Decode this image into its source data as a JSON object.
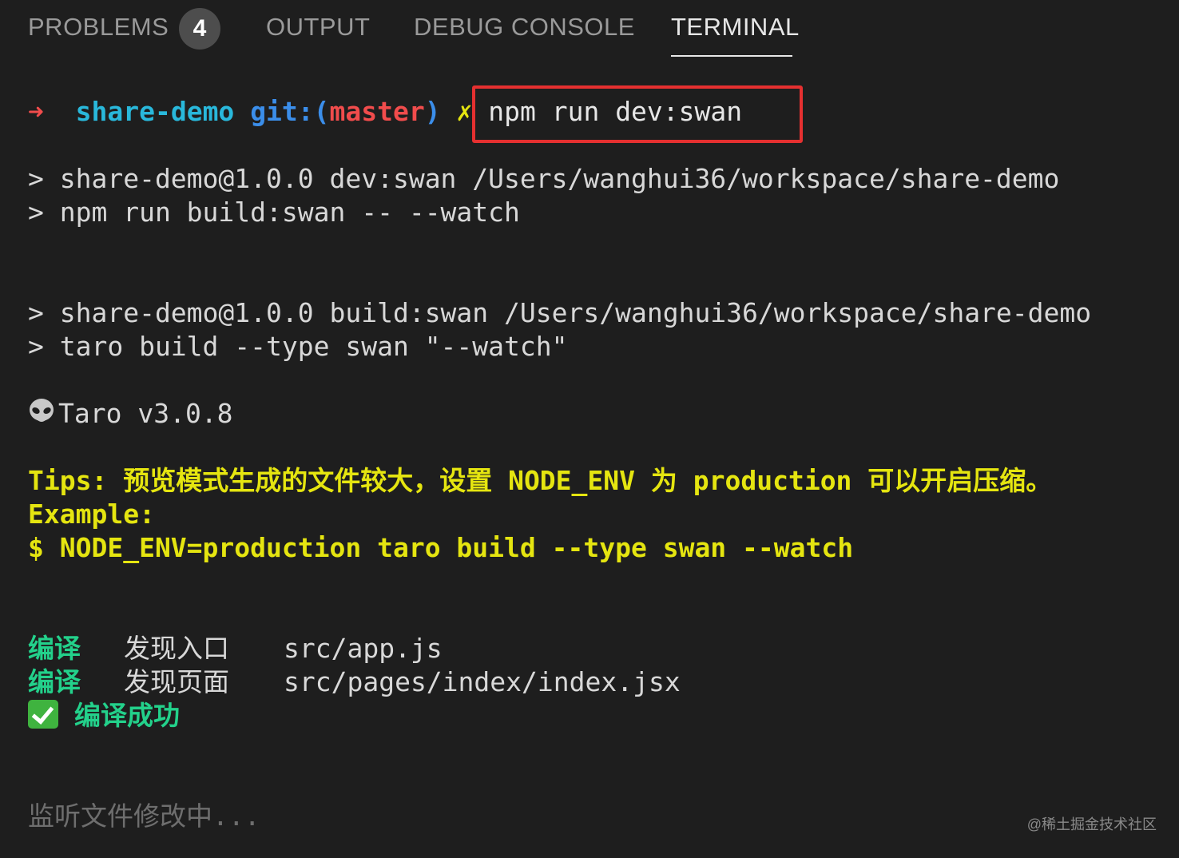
{
  "tabs": {
    "problems_label": "PROBLEMS",
    "problems_count": "4",
    "output_label": "OUTPUT",
    "debug_console_label": "DEBUG CONSOLE",
    "terminal_label": "TERMINAL",
    "active": "TERMINAL"
  },
  "prompt": {
    "arrow": "➜",
    "directory": "share-demo",
    "git_prefix": "git:(",
    "branch": "master",
    "git_suffix": ")",
    "dirty_mark": "✗",
    "command": "npm run dev:swan"
  },
  "output": {
    "line1": "> share-demo@1.0.0 dev:swan /Users/wanghui36/workspace/share-demo",
    "line2": "> npm run build:swan -- --watch",
    "line3": "> share-demo@1.0.0 build:swan /Users/wanghui36/workspace/share-demo",
    "line4": "> taro build --type swan \"--watch\"",
    "taro_icon": "alien-icon",
    "taro_version": "Taro v3.0.8",
    "tips": "Tips: 预览模式生成的文件较大，设置 NODE_ENV 为 production 可以开启压缩。",
    "example_label": "Example:",
    "example_cmd": "$ NODE_ENV=production taro build --type swan --watch",
    "compile1_label": "编译",
    "compile1_action": "发现入口",
    "compile1_path": "src/app.js",
    "compile2_label": "编译",
    "compile2_action": "发现页面",
    "compile2_path": "src/pages/index/index.jsx",
    "success_icon": "check-icon",
    "success_text": "编译成功",
    "watching": "监听文件修改中..."
  },
  "watermark": "@稀土掘金技术社区",
  "colors": {
    "background": "#1e1e1e",
    "highlight_box": "#e53030",
    "yellow": "#e5e510",
    "green": "#23d18b",
    "cyan": "#29b8db",
    "red": "#f14c4c"
  }
}
